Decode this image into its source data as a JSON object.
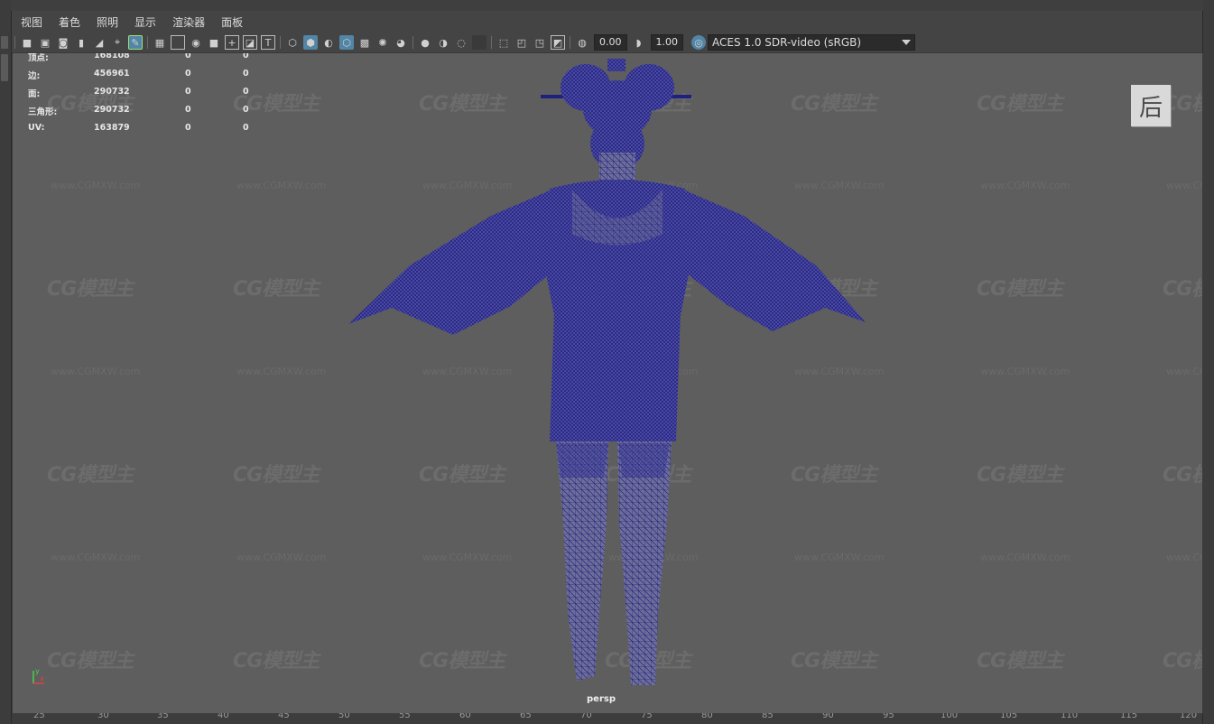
{
  "menu": [
    "视图",
    "着色",
    "照明",
    "显示",
    "渲染器",
    "面板"
  ],
  "toolbar": {
    "exposure_value": "0.00",
    "gamma_value": "1.00",
    "color_space": "ACES 1.0 SDR-video (sRGB)"
  },
  "hud": {
    "rows": [
      {
        "label": "顶点:",
        "count": "168108",
        "a": "0",
        "b": "0"
      },
      {
        "label": "边:",
        "count": "456961",
        "a": "0",
        "b": "0"
      },
      {
        "label": "面:",
        "count": "290732",
        "a": "0",
        "b": "0"
      },
      {
        "label": "三角形:",
        "count": "290732",
        "a": "0",
        "b": "0"
      },
      {
        "label": "UV:",
        "count": "163879",
        "a": "0",
        "b": "0"
      }
    ]
  },
  "viewport": {
    "camera": "persp",
    "view_badge": "后"
  },
  "axis": {
    "x": "x",
    "y": "y"
  },
  "watermark": {
    "logo": "CG模型主",
    "url": "www.CGMXW.com"
  },
  "ruler": {
    "ticks": [
      "25",
      "30",
      "35",
      "40",
      "45",
      "50",
      "55",
      "60",
      "65",
      "70",
      "75",
      "80",
      "85",
      "90",
      "95",
      "100",
      "105",
      "110",
      "115",
      "120"
    ]
  },
  "colors": {
    "wireframe": "#1f1f80",
    "viewport_bg": "#5e5e5e",
    "active_icon": "#5285a6"
  }
}
